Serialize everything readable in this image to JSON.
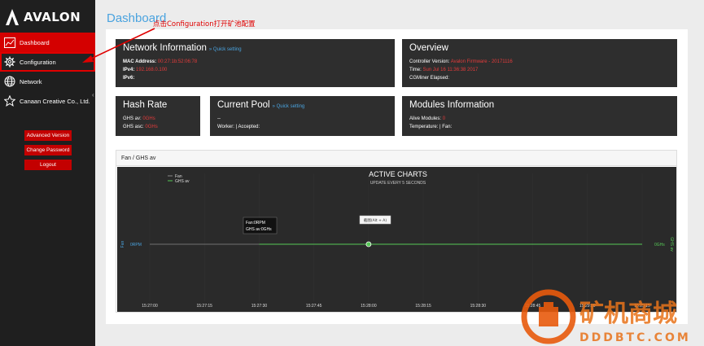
{
  "brand": {
    "name": "AVALON"
  },
  "sidebar": {
    "items": [
      {
        "label": "Dashboard",
        "icon": "line-chart-icon"
      },
      {
        "label": "Configuration",
        "icon": "gear-icon"
      },
      {
        "label": "Network",
        "icon": "globe-icon"
      },
      {
        "label": "Canaan Creative Co., Ltd.",
        "icon": "star-icon"
      }
    ],
    "buttons": {
      "advanced": "Advanced Version",
      "password": "Change Password",
      "logout": "Logout"
    }
  },
  "page": {
    "title": "Dashboard"
  },
  "annotation": "点击Configuration打开矿池配置",
  "network": {
    "title": "Network Information",
    "quick": "» Quick setting",
    "mac_label": "MAC Address:",
    "mac_value": "00:27:1b:52:06:78",
    "ipv4_label": "IPv4:",
    "ipv4_value": "192.168.0.100",
    "ipv6_label": "IPv6:",
    "ipv6_value": ""
  },
  "overview": {
    "title": "Overview",
    "controller_label": "Controller Version:",
    "controller_value": "Avalon Firmware - 20171116",
    "time_label": "Time:",
    "time_value": "Sun Jul 16 11:36:38 2017",
    "elapsed_label": "CGMiner Elapsed:",
    "elapsed_value": ""
  },
  "hash": {
    "title": "Hash Rate",
    "av_label": "GHS av:",
    "av_value": "0GHs",
    "asc_label": "GHS asc:",
    "asc_value": "0GHs"
  },
  "pool": {
    "title": "Current Pool",
    "quick": "» Quick setting",
    "dash": "--",
    "worker_label": "Worker:",
    "worker_sep": "| Accepted:"
  },
  "modules": {
    "title": "Modules Information",
    "alive_label": "Alive Modules:",
    "alive_value": "0",
    "temp_label": "Temperature:",
    "fan_label": "| Fan:"
  },
  "chart_panel": {
    "title": "Fan / GHS av"
  },
  "chart_data": {
    "type": "line",
    "title": "ACTIVE CHARTS",
    "subtitle": "UPDATE EVERY 5 SECONDS",
    "x": [
      "15:27:00",
      "15:27:15",
      "15:27:30",
      "15:27:45",
      "15:28:00",
      "15:28:15",
      "15:28:30",
      "15:28:45",
      "15:29:00",
      "15:29:15"
    ],
    "series": [
      {
        "name": "Fan",
        "values": [
          0,
          0,
          0,
          0,
          0,
          0,
          0,
          0,
          0,
          0
        ],
        "color": "#888888"
      },
      {
        "name": "GHS av",
        "values": [
          null,
          null,
          0,
          0,
          0,
          0,
          0,
          0,
          0,
          0
        ],
        "color": "#56c856"
      }
    ],
    "ylabel_left": "Fan",
    "ylabel_right": "GHS av",
    "left_tick": "0RPM",
    "right_tick": "0GHs",
    "tooltip": {
      "line1": "Fan:0RPM",
      "line2": "GHS av:0GHs"
    },
    "screenshot_hint": "截图(Alt + A)",
    "legend_position": "top-left",
    "grid": true
  },
  "colors": {
    "accent": "#d40000",
    "link": "#4aa3df",
    "card": "#2e2e2e",
    "sidebar": "#1f1f1f",
    "series_green": "#56c856"
  },
  "watermark": {
    "cn": "矿机商城",
    "en": "DDDBTC.COM"
  }
}
